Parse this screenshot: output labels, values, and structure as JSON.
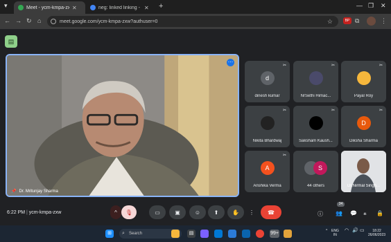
{
  "browser": {
    "tabs": [
      {
        "label": "Meet - ycm-kmpa-zxw",
        "active": true,
        "favicon_color": "#34a853"
      },
      {
        "label": "neg: linked linking - Google S",
        "active": false,
        "favicon_color": "#4285f4"
      }
    ],
    "url": "meet.google.com/ycm-kmpa-zxw?authuser=0",
    "ext_label": "BP"
  },
  "meeting": {
    "presenter_name": "Dr. Mritunjay Sharma",
    "code": "ycm-kmpa-zxw",
    "time": "6:22 PM",
    "participant_count": "34",
    "participants": [
      {
        "name": "dinesh kumar",
        "initial": "d",
        "avatar_color": "#5f6368",
        "type": "initial"
      },
      {
        "name": "NrSethi Himac...",
        "initial": "",
        "avatar_color": "#4a4a6a",
        "type": "photo"
      },
      {
        "name": "Payal Roy",
        "initial": "",
        "avatar_color": "#f6b73c",
        "type": "photo"
      },
      {
        "name": "Nikita Bhardwaj",
        "initial": "",
        "avatar_color": "#222",
        "type": "photo"
      },
      {
        "name": "Saksham Kaush...",
        "initial": "",
        "avatar_color": "#000000",
        "type": "photo"
      },
      {
        "name": "Diksha Sharma",
        "initial": "D",
        "avatar_color": "#e8590c",
        "type": "initial"
      },
      {
        "name": "Anshika Verma",
        "initial": "A",
        "avatar_color": "#f4511e",
        "type": "initial"
      },
      {
        "name": "44 others",
        "initial": "S",
        "avatar_color": "#c2185b",
        "type": "others"
      },
      {
        "name": "Dr.Nirmal Singh...",
        "initial": "",
        "avatar_color": "#7d8b99",
        "type": "video"
      }
    ]
  },
  "taskbar": {
    "search_placeholder": "Search",
    "lang_top": "ENG",
    "lang_bottom": "IN",
    "clock_time": "18:22",
    "clock_date": "26/06/2023",
    "notification_count": "99+"
  }
}
